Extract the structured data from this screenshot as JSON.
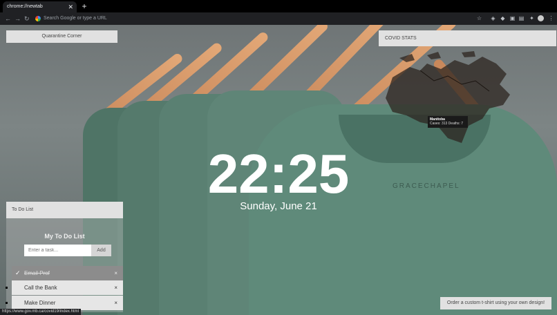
{
  "browser": {
    "tab_title": "chrome://newtab",
    "tab_close": "✕",
    "new_tab": "+",
    "omnibox_placeholder": "Search Google or type a URL",
    "back": "←",
    "forward": "→",
    "reload": "↻"
  },
  "widgets": {
    "quarantine_button": "Quarantine Corner",
    "covid_header": "COVID STATS",
    "tooltip_region": "Manitoba",
    "tooltip_stats": "Cases: 313 Deaths: 7",
    "order_button": "Order a custom t-shirt using your own design!"
  },
  "clock": {
    "time": "22:25",
    "date": "Sunday, June 21"
  },
  "todo": {
    "header": "To Do List",
    "title": "My To Do List",
    "input_placeholder": "Enter a task...",
    "add_label": "Add",
    "items": [
      {
        "label": "Email Prof",
        "done": true,
        "close": "×"
      },
      {
        "label": "Call the Bank",
        "done": false,
        "close": "×"
      },
      {
        "label": "Make Dinner",
        "done": false,
        "close": "×"
      }
    ]
  },
  "status_url": "https://www.gov.mb.ca/covid19/index.html",
  "colors": {
    "shirt": "#5f8a7a",
    "hanger": "#d8995f",
    "panel": "#e1e1e1"
  }
}
